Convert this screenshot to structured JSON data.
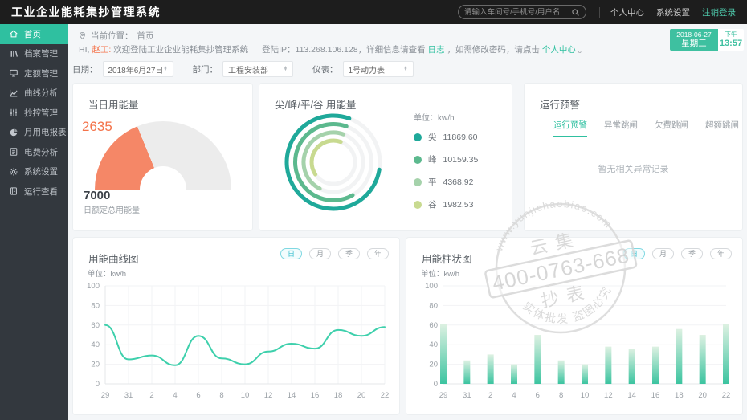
{
  "app_title": "工业企业能耗集抄管理系统",
  "topbar": {
    "search_placeholder": "请输入车间号/手机号/用户名",
    "links": [
      "个人中心",
      "系统设置",
      "注销登录"
    ]
  },
  "sidebar": {
    "items": [
      {
        "label": "首页",
        "icon": "home-icon",
        "active": true
      },
      {
        "label": "档案管理",
        "icon": "archive-icon",
        "active": false
      },
      {
        "label": "定额管理",
        "icon": "monitor-icon",
        "active": false
      },
      {
        "label": "曲线分析",
        "icon": "curve-icon",
        "active": false
      },
      {
        "label": "抄控管理",
        "icon": "sliders-icon",
        "active": false
      },
      {
        "label": "月用电报表",
        "icon": "pie-icon",
        "active": false
      },
      {
        "label": "电费分析",
        "icon": "report-icon",
        "active": false
      },
      {
        "label": "系统设置",
        "icon": "gear-icon",
        "active": false
      },
      {
        "label": "运行查看",
        "icon": "log-icon",
        "active": false
      }
    ]
  },
  "breadcrumb": {
    "label": "当前位置：",
    "current": "首页"
  },
  "welcome": {
    "hi": "HI, ",
    "user": "赵工:",
    "text": " 欢迎登陆工业企业能耗集抄管理系统",
    "ip": "登陆IP：113.268.106.128，详细信息请查看",
    "log_link": "日志",
    "mid": "，如需修改密码，请点击",
    "center_link": "个人中心",
    "end": "。"
  },
  "clock": {
    "date": "2018-06-27",
    "weekday": "星期三",
    "meridiem": "下午",
    "time": "13:57"
  },
  "filters": [
    {
      "name": "date",
      "label": "日期：",
      "value": "2018年6月27日"
    },
    {
      "name": "dept",
      "label": "部门：",
      "value": "工程安装部"
    },
    {
      "name": "meter",
      "label": "仪表：",
      "value": "1号动力表"
    }
  ],
  "cards": {
    "gauge": {
      "title": "当日用能量",
      "quota_label": "日额定总用能量"
    },
    "rings": {
      "title": "尖/峰/平/谷 用能量",
      "unit": "单位：kw/h"
    },
    "alarm": {
      "title": "运行预警",
      "tabs": [
        "运行预警",
        "异常跳闸",
        "欠费跳闸",
        "超额跳闸"
      ],
      "active_tab": 0,
      "empty_text": "暂无相关异常记录"
    },
    "line": {
      "title": "用能曲线图",
      "unit": "单位：kw/h",
      "periods": [
        "日",
        "月",
        "季",
        "年"
      ],
      "active_period": 0
    },
    "bar": {
      "title": "用能柱状图",
      "unit": "单位：kw/h",
      "periods": [
        "日",
        "月",
        "季",
        "年"
      ],
      "active_period": 0
    }
  },
  "chart_data": [
    {
      "type": "gauge",
      "title": "当日用能量",
      "value": 2635,
      "max": 7000,
      "color": "#f58767",
      "track_color": "#ececec"
    },
    {
      "type": "ring",
      "title": "尖/峰/平/谷 用能量",
      "unit": "kw/h",
      "series": [
        {
          "name": "尖",
          "value": 11869.6,
          "fraction": 0.78,
          "color": "#1fa99a"
        },
        {
          "name": "峰",
          "value": 10159.35,
          "fraction": 0.64,
          "color": "#5cb98e"
        },
        {
          "name": "平",
          "value": 4368.92,
          "fraction": 0.48,
          "color": "#a5d2ab"
        },
        {
          "name": "谷",
          "value": 1982.53,
          "fraction": 0.4,
          "color": "#c8da90"
        }
      ]
    },
    {
      "type": "line",
      "title": "用能曲线图",
      "xlabel": "",
      "ylabel": "kw/h",
      "categories": [
        "29",
        "31",
        "2",
        "4",
        "6",
        "8",
        "10",
        "12",
        "14",
        "16",
        "18",
        "20",
        "22"
      ],
      "values": [
        60,
        25,
        29,
        19,
        49,
        26,
        20,
        33,
        41,
        36,
        55,
        49,
        58
      ],
      "ylim": [
        0,
        100
      ],
      "yticks": [
        0,
        20,
        40,
        60,
        80,
        100
      ],
      "grid": true,
      "color": "#3ed0ac"
    },
    {
      "type": "bar",
      "title": "用能柱状图",
      "xlabel": "",
      "ylabel": "kw/h",
      "categories": [
        "29",
        "31",
        "2",
        "4",
        "6",
        "8",
        "10",
        "12",
        "14",
        "16",
        "18",
        "20",
        "22"
      ],
      "values": [
        61,
        24,
        30,
        20,
        50,
        24,
        20,
        38,
        36,
        38,
        56,
        50,
        61
      ],
      "ylim": [
        0,
        100
      ],
      "yticks": [
        0,
        20,
        40,
        60,
        80,
        100
      ],
      "grid": true,
      "color_top": "#ddf1e2",
      "color_bottom": "#3cc4a0"
    }
  ],
  "watermark": {
    "arc_top": "www.yunjichaobiao.com",
    "name_top": "云集",
    "phone": "400-0763-668",
    "name_bottom": "抄表",
    "arc_bottom": "实体批发 盗图必究"
  },
  "colors": {
    "accent": "#2fc0a0",
    "orange": "#f58767"
  }
}
